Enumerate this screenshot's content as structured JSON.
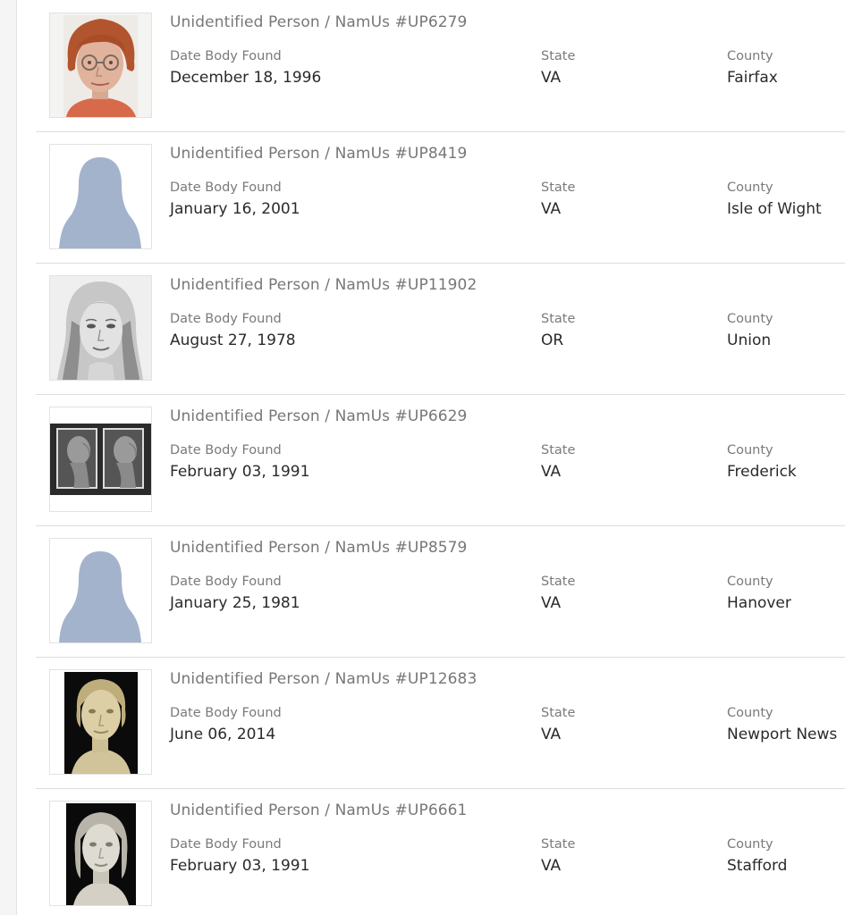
{
  "labels": {
    "date": "Date Body Found",
    "state": "State",
    "county": "County"
  },
  "colors": {
    "title": "#777777",
    "label": "#7a7a7a",
    "value": "#2a2a2a",
    "divider": "#dcdcdc",
    "silhouette": "#a3b3cc"
  },
  "cases": [
    {
      "title": "Unidentified Person / NamUs #UP6279",
      "date": "December 18, 1996",
      "state": "VA",
      "county": "Fairfax",
      "image": "photo-woman-glasses"
    },
    {
      "title": "Unidentified Person / NamUs #UP8419",
      "date": "January 16, 2001",
      "state": "VA",
      "county": "Isle of Wight",
      "image": "silhouette-placeholder"
    },
    {
      "title": "Unidentified Person / NamUs #UP11902",
      "date": "August 27, 1978",
      "state": "OR",
      "county": "Union",
      "image": "sketch-woman-long-hair"
    },
    {
      "title": "Unidentified Person / NamUs #UP6629",
      "date": "February 03, 1991",
      "state": "VA",
      "county": "Frederick",
      "image": "photo-skull-reconstruction-pair"
    },
    {
      "title": "Unidentified Person / NamUs #UP8579",
      "date": "January 25, 1981",
      "state": "VA",
      "county": "Hanover",
      "image": "silhouette-placeholder"
    },
    {
      "title": "Unidentified Person / NamUs #UP12683",
      "date": "June 06, 2014",
      "state": "VA",
      "county": "Newport News",
      "image": "photo-clay-reconstruction"
    },
    {
      "title": "Unidentified Person / NamUs #UP6661",
      "date": "February 03, 1991",
      "state": "VA",
      "county": "Stafford",
      "image": "photo-clay-reconstruction"
    }
  ]
}
